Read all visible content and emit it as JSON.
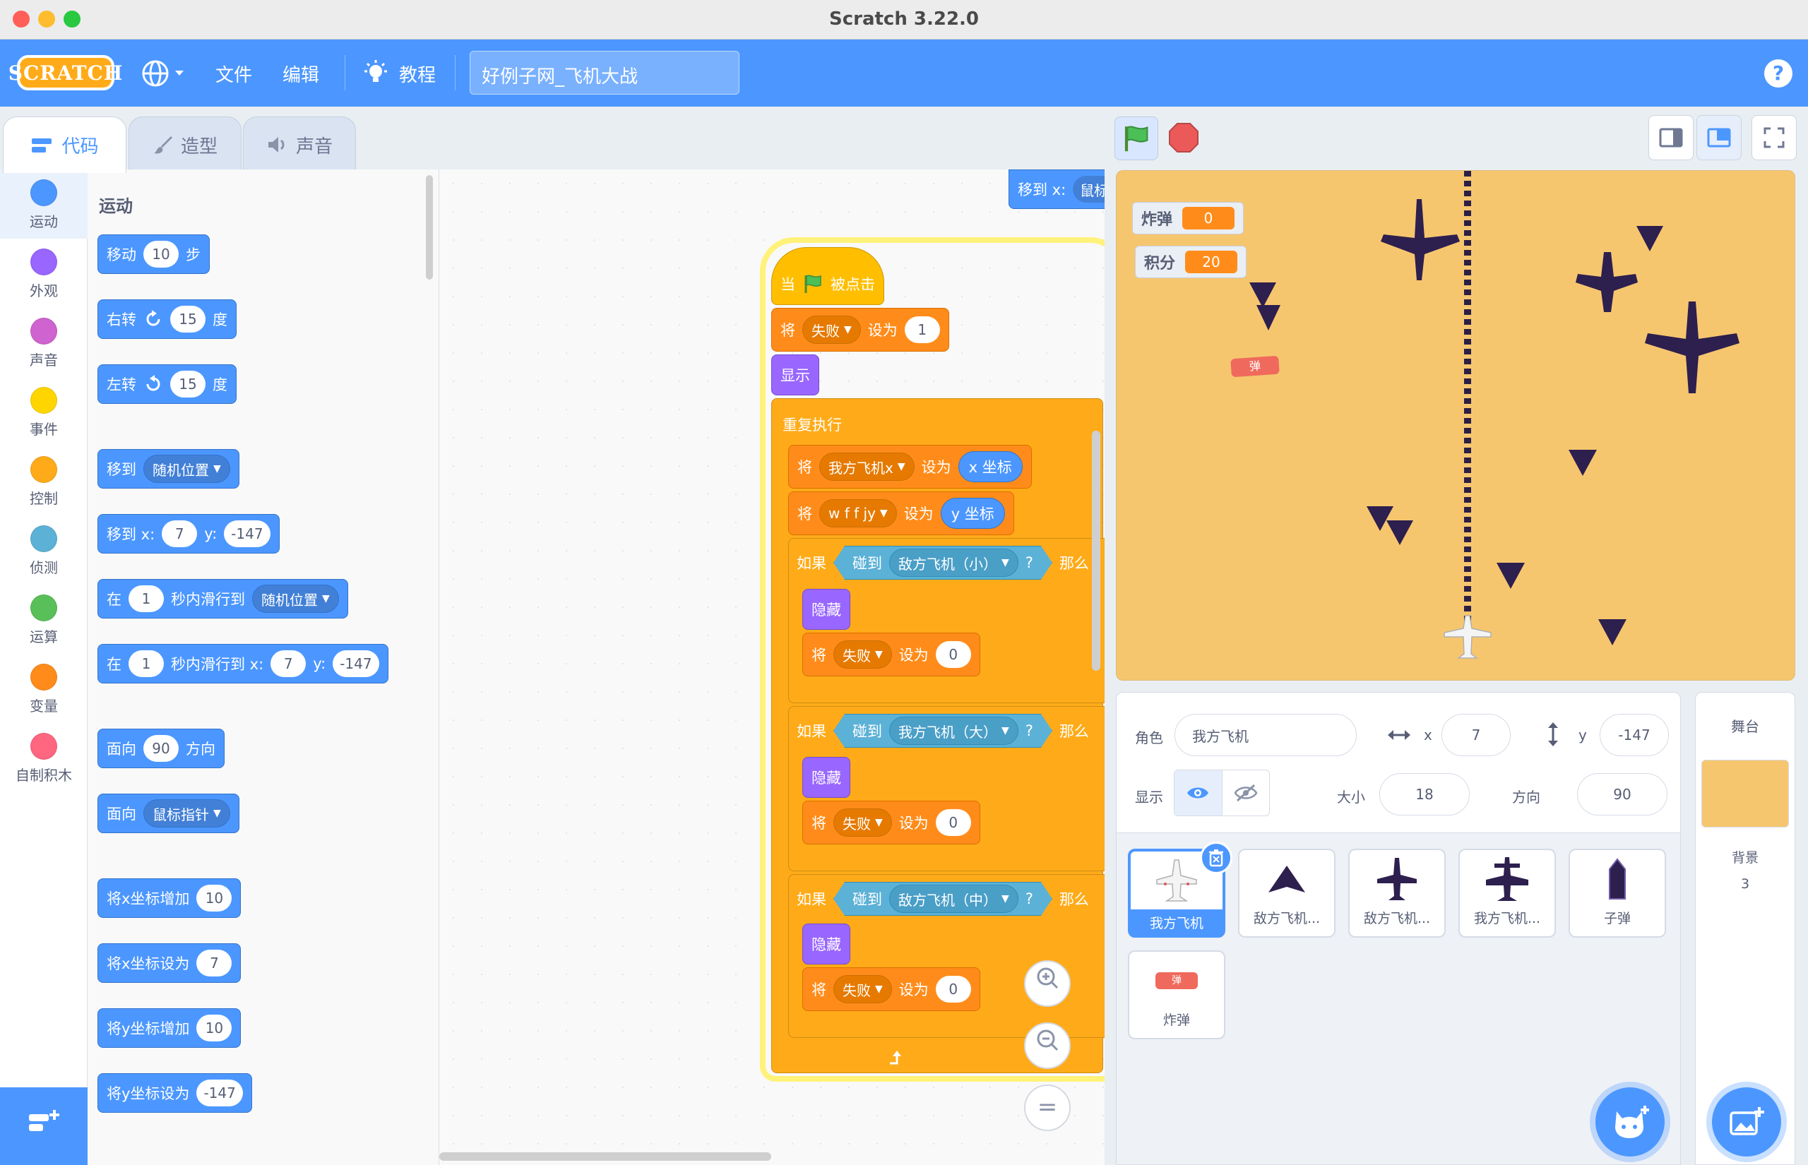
{
  "window": {
    "title": "Scratch 3.22.0"
  },
  "menubar": {
    "logo": "SCRATCH",
    "file": "文件",
    "edit": "编辑",
    "tutorials": "教程",
    "project_title": "好例子网_飞机大战",
    "help": "?"
  },
  "tabs": {
    "code": "代码",
    "costumes": "造型",
    "sounds": "声音"
  },
  "categories": [
    {
      "label": "运动",
      "color": "#4c97ff"
    },
    {
      "label": "外观",
      "color": "#9966ff"
    },
    {
      "label": "声音",
      "color": "#cf63cf"
    },
    {
      "label": "事件",
      "color": "#ffd500"
    },
    {
      "label": "控制",
      "color": "#ffab19"
    },
    {
      "label": "侦测",
      "color": "#5cb1d6"
    },
    {
      "label": "运算",
      "color": "#59c059"
    },
    {
      "label": "变量",
      "color": "#ff8c1a"
    },
    {
      "label": "自制积木",
      "color": "#ff6680"
    }
  ],
  "palette": {
    "title": "运动",
    "move": {
      "a": "移动",
      "n": "10",
      "b": "步"
    },
    "turn_right": {
      "a": "右转",
      "n": "15",
      "b": "度"
    },
    "turn_left": {
      "a": "左转",
      "n": "15",
      "b": "度"
    },
    "goto": {
      "a": "移到",
      "d": "随机位置"
    },
    "goto_xy": {
      "a": "移到 x:",
      "x": "7",
      "b": "y:",
      "y": "-147"
    },
    "glide": {
      "a": "在",
      "n": "1",
      "b": "秒内滑行到",
      "d": "随机位置"
    },
    "glide_xy": {
      "a": "在",
      "n": "1",
      "b": "秒内滑行到 x:",
      "x": "7",
      "c": "y:",
      "y": "-147"
    },
    "point_dir": {
      "a": "面向",
      "n": "90",
      "b": "方向"
    },
    "point_towards": {
      "a": "面向",
      "d": "鼠标指针"
    },
    "change_x": {
      "a": "将x坐标增加",
      "n": "10"
    },
    "set_x": {
      "a": "将x坐标设为",
      "n": "7"
    },
    "change_y": {
      "a": "将y坐标增加",
      "n": "10"
    },
    "set_y": {
      "a": "将y坐标设为",
      "n": "-147"
    }
  },
  "script": {
    "partial_top": {
      "a": "移到 x:",
      "b": "鼠标"
    },
    "hat": {
      "a": "当",
      "b": "被点击"
    },
    "set_fail_1": {
      "a": "将",
      "var": "失败",
      "b": "设为",
      "n": "1"
    },
    "show": "显示",
    "forever": "重复执行",
    "set_plane_x": {
      "a": "将",
      "var": "我方飞机x",
      "b": "设为",
      "r": "x 坐标"
    },
    "set_wffjy": {
      "a": "将",
      "var": "w f f jy",
      "b": "设为",
      "r": "y 坐标"
    },
    "if1": {
      "a": "如果",
      "b": "碰到",
      "obj": "敌方飞机（小）",
      "q": "?",
      "c": "那么"
    },
    "hide1": "隐藏",
    "set_fail_a": {
      "a": "将",
      "var": "失败",
      "b": "设为",
      "n": "0"
    },
    "if2": {
      "a": "如果",
      "b": "碰到",
      "obj": "我方飞机（大）",
      "q": "?",
      "c": "那么"
    },
    "hide2": "隐藏",
    "set_fail_b": {
      "a": "将",
      "var": "失败",
      "b": "设为",
      "n": "0"
    },
    "if3": {
      "a": "如果",
      "b": "碰到",
      "obj": "敌方飞机（中）",
      "q": "?",
      "c": "那么"
    },
    "hide3": "隐藏",
    "set_fail_c": {
      "a": "将",
      "var": "失败",
      "b": "设为",
      "n": "0"
    }
  },
  "zoom": {
    "in": "+",
    "out": "−",
    "reset": "="
  },
  "stage": {
    "monitors": [
      {
        "label": "炸弹",
        "value": "0"
      },
      {
        "label": "积分",
        "value": "20"
      }
    ],
    "bomb_label": "弹"
  },
  "sprite_info": {
    "sprite_label": "角色",
    "sprite_name": "我方飞机",
    "x_label": "x",
    "x": "7",
    "y_label": "y",
    "y": "-147",
    "show_label": "显示",
    "size_label": "大小",
    "size": "18",
    "direction_label": "方向",
    "direction": "90"
  },
  "sprites": [
    {
      "name": "我方飞机"
    },
    {
      "name": "敌方飞机..."
    },
    {
      "name": "敌方飞机..."
    },
    {
      "name": "我方飞机..."
    },
    {
      "name": "子弹"
    },
    {
      "name": "炸弹",
      "thumb_label": "弹"
    }
  ],
  "stage_panel": {
    "title": "舞台",
    "backdrop_label": "背景",
    "backdrop_count": "3"
  }
}
